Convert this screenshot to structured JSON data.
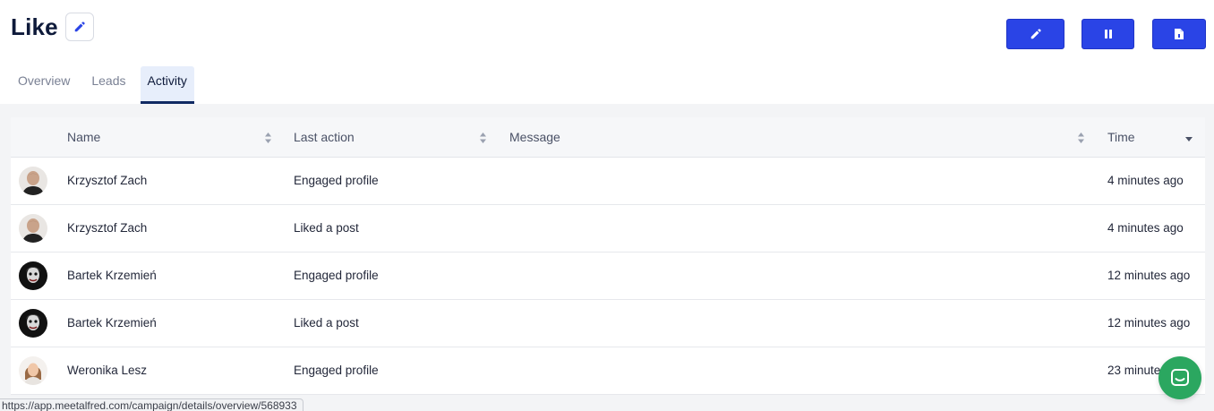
{
  "header": {
    "title": "Like"
  },
  "tabs": [
    {
      "label": "Overview",
      "active": false
    },
    {
      "label": "Leads",
      "active": false
    },
    {
      "label": "Activity",
      "active": true
    }
  ],
  "toolbar": {
    "buttons": [
      {
        "icon": "pencil-icon"
      },
      {
        "icon": "pause-icon"
      },
      {
        "icon": "document-icon"
      }
    ],
    "accent": "#2a44e6"
  },
  "table": {
    "columns": [
      "Name",
      "Last action",
      "Message",
      "Time"
    ],
    "rows": [
      {
        "name": "Krzysztof Zach",
        "action": "Engaged profile",
        "message": "",
        "time": "4 minutes ago",
        "avatar": "krzysztof"
      },
      {
        "name": "Krzysztof Zach",
        "action": "Liked a post",
        "message": "",
        "time": "4 minutes ago",
        "avatar": "krzysztof"
      },
      {
        "name": "Bartek Krzemień",
        "action": "Engaged profile",
        "message": "",
        "time": "12 minutes ago",
        "avatar": "bartek"
      },
      {
        "name": "Bartek Krzemień",
        "action": "Liked a post",
        "message": "",
        "time": "12 minutes ago",
        "avatar": "bartek"
      },
      {
        "name": "Weronika Lesz",
        "action": "Engaged profile",
        "message": "",
        "time": "23 minutes ago",
        "avatar": "weronika"
      }
    ]
  },
  "status_bar": {
    "url": "https://app.meetalfred.com/campaign/details/overview/568933"
  },
  "chat": {
    "icon": "chat-icon",
    "color": "#2ba760"
  }
}
